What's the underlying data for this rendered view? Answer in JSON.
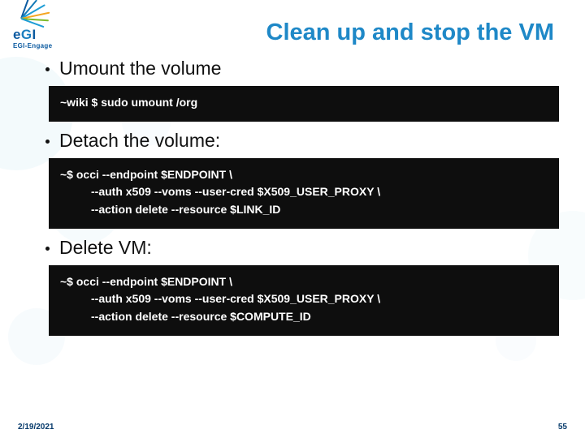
{
  "logo": {
    "main": "eGI",
    "sub": "EGI-Engage"
  },
  "title": "Clean up and stop the VM",
  "sections": [
    {
      "bullet": "Umount the volume",
      "code_lines": [
        "~wiki $ sudo umount /org"
      ]
    },
    {
      "bullet": "Detach the volume:",
      "code_lines": [
        "~$ occi --endpoint $ENDPOINT \\",
        "--auth x509 --voms --user-cred $X509_USER_PROXY \\",
        "--action delete --resource $LINK_ID"
      ]
    },
    {
      "bullet": "Delete VM:",
      "code_lines": [
        "~$ occi --endpoint $ENDPOINT \\",
        "--auth x509 --voms --user-cred $X509_USER_PROXY \\",
        "--action delete --resource $COMPUTE_ID"
      ]
    }
  ],
  "footer": {
    "date": "2/19/2021",
    "page": "55"
  }
}
